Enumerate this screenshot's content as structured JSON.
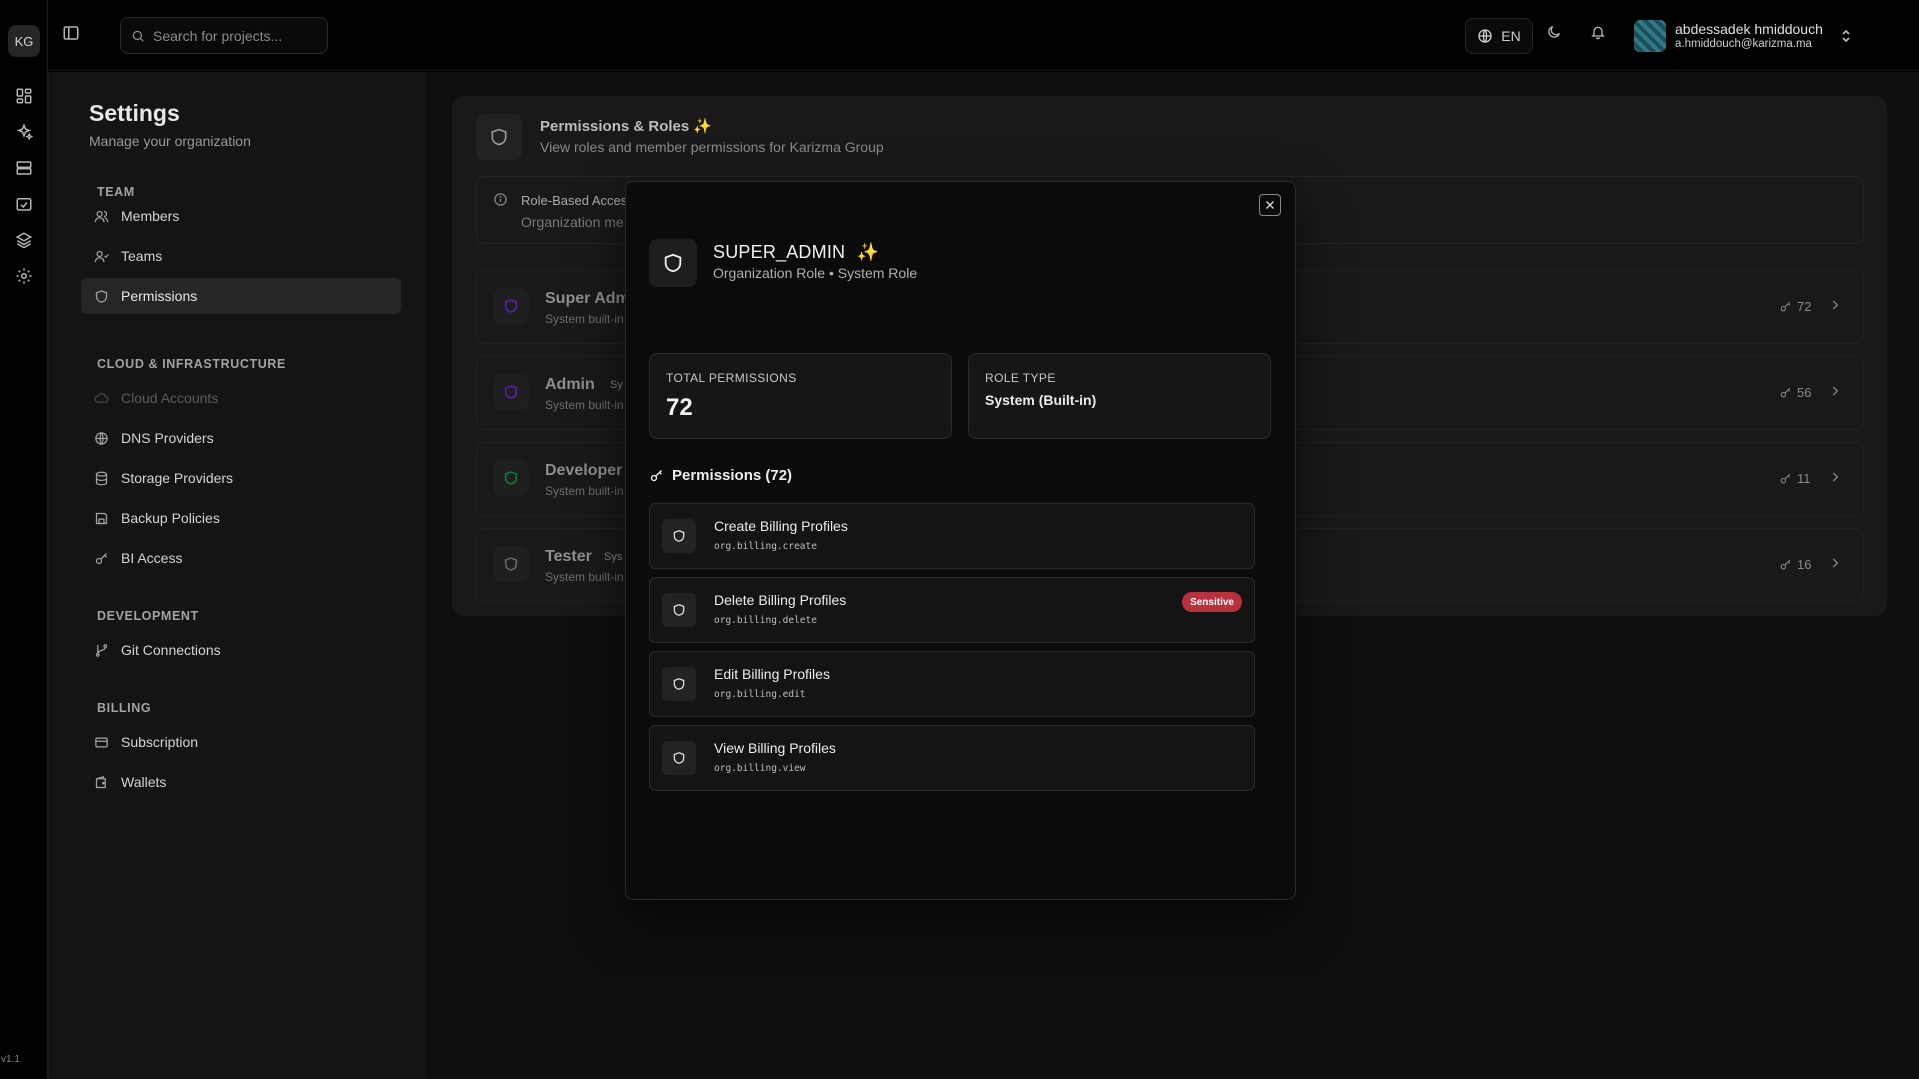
{
  "rail": {
    "logo": "KG",
    "version": "v1.1",
    "icons": [
      "dashboard-icon",
      "sparkles-icon",
      "server-icon",
      "folder-icon",
      "layers-icon",
      "gear-icon"
    ]
  },
  "topbar": {
    "search_placeholder": "Search for projects...",
    "language": "EN",
    "user": {
      "name": "abdessadek hmiddouch",
      "email": "a.hmiddouch@karizma.ma"
    }
  },
  "settings": {
    "title": "Settings",
    "subtitle": "Manage your organization",
    "sections": [
      {
        "label": "TEAM",
        "items": [
          {
            "label": "Members",
            "icon": "users-icon"
          },
          {
            "label": "Teams",
            "icon": "user-group-icon"
          },
          {
            "label": "Permissions",
            "icon": "shield-icon",
            "active": true
          }
        ]
      },
      {
        "label": "CLOUD & INFRASTRUCTURE",
        "items": [
          {
            "label": "Cloud Accounts",
            "icon": "cloud-icon",
            "disabled": true
          },
          {
            "label": "DNS Providers",
            "icon": "globe-icon"
          },
          {
            "label": "Storage Providers",
            "icon": "database-icon"
          },
          {
            "label": "Backup Policies",
            "icon": "save-icon"
          },
          {
            "label": "BI Access",
            "icon": "key-icon"
          }
        ]
      },
      {
        "label": "DEVELOPMENT",
        "items": [
          {
            "label": "Git Connections",
            "icon": "git-branch-icon"
          }
        ]
      },
      {
        "label": "BILLING",
        "items": [
          {
            "label": "Subscription",
            "icon": "credit-card-icon"
          },
          {
            "label": "Wallets",
            "icon": "wallet-icon"
          }
        ]
      }
    ]
  },
  "main": {
    "title": "Permissions & Roles",
    "title_emoji": "✨",
    "subtitle": "View roles and member permissions for Karizma Group",
    "info": {
      "title": "Role-Based Acces",
      "text": "Organization me"
    },
    "roles": [
      {
        "name": "Super Adm",
        "badge": "",
        "desc": "System built-in",
        "count": "72",
        "color": "#6d28d9"
      },
      {
        "name": "Admin",
        "badge": "Sy",
        "desc": "System built-in",
        "count": "56",
        "color": "#6d28d9"
      },
      {
        "name": "Developer",
        "badge": "",
        "desc": "System built-in",
        "count": "11",
        "color": "#15803d"
      },
      {
        "name": "Tester",
        "badge": "Sys",
        "desc": "System built-in",
        "count": "16",
        "color": "#6b6b6b"
      }
    ]
  },
  "modal": {
    "title": "SUPER_ADMIN",
    "title_emoji": "✨",
    "subtitle": "Organization Role • System Role",
    "stats": {
      "total_label": "TOTAL PERMISSIONS",
      "total_value": "72",
      "type_label": "ROLE TYPE",
      "type_value": "System (Built-in)"
    },
    "permissions_header": "Permissions (72)",
    "permissions": [
      {
        "name": "Create Billing Profiles",
        "code": "org.billing.create",
        "sensitive": false
      },
      {
        "name": "Delete Billing Profiles",
        "code": "org.billing.delete",
        "sensitive": true,
        "badge": "Sensitive"
      },
      {
        "name": "Edit Billing Profiles",
        "code": "org.billing.edit",
        "sensitive": false
      },
      {
        "name": "View Billing Profiles",
        "code": "org.billing.view",
        "sensitive": false
      }
    ]
  },
  "colors": {
    "accent_sensitive": "#b8323d",
    "emoji_gold": "#f5c542"
  }
}
